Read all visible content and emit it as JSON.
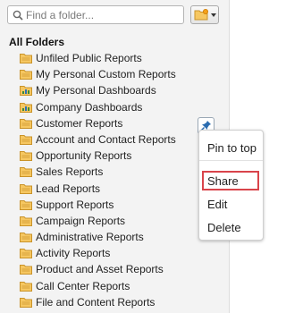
{
  "search": {
    "placeholder": "Find a folder..."
  },
  "tree": {
    "heading": "All Folders",
    "folders": [
      {
        "label": "Unfiled Public Reports",
        "icon": "folder-icon"
      },
      {
        "label": "My Personal Custom Reports",
        "icon": "folder-icon"
      },
      {
        "label": "My Personal Dashboards",
        "icon": "dashboard-icon"
      },
      {
        "label": "Company Dashboards",
        "icon": "dashboard-icon"
      },
      {
        "label": "Customer Reports",
        "icon": "folder-icon"
      },
      {
        "label": "Account and Contact Reports",
        "icon": "folder-icon"
      },
      {
        "label": "Opportunity Reports",
        "icon": "folder-icon"
      },
      {
        "label": "Sales Reports",
        "icon": "folder-icon"
      },
      {
        "label": "Lead Reports",
        "icon": "folder-icon"
      },
      {
        "label": "Support Reports",
        "icon": "folder-icon"
      },
      {
        "label": "Campaign Reports",
        "icon": "folder-icon"
      },
      {
        "label": "Administrative Reports",
        "icon": "folder-icon"
      },
      {
        "label": "Activity Reports",
        "icon": "folder-icon"
      },
      {
        "label": "Product and Asset Reports",
        "icon": "folder-icon"
      },
      {
        "label": "Call Center Reports",
        "icon": "folder-icon"
      },
      {
        "label": "File and Content Reports",
        "icon": "folder-icon"
      }
    ]
  },
  "context_menu": {
    "items": [
      {
        "label": "Pin to top"
      },
      {
        "label": "Share",
        "highlighted": true
      },
      {
        "label": "Edit"
      },
      {
        "label": "Delete"
      }
    ]
  },
  "colors": {
    "panel_bg": "#f3f3f3",
    "folder_fill": "#f6c761",
    "highlight_border": "#d9444b",
    "pin_blue": "#2b6cb0"
  }
}
